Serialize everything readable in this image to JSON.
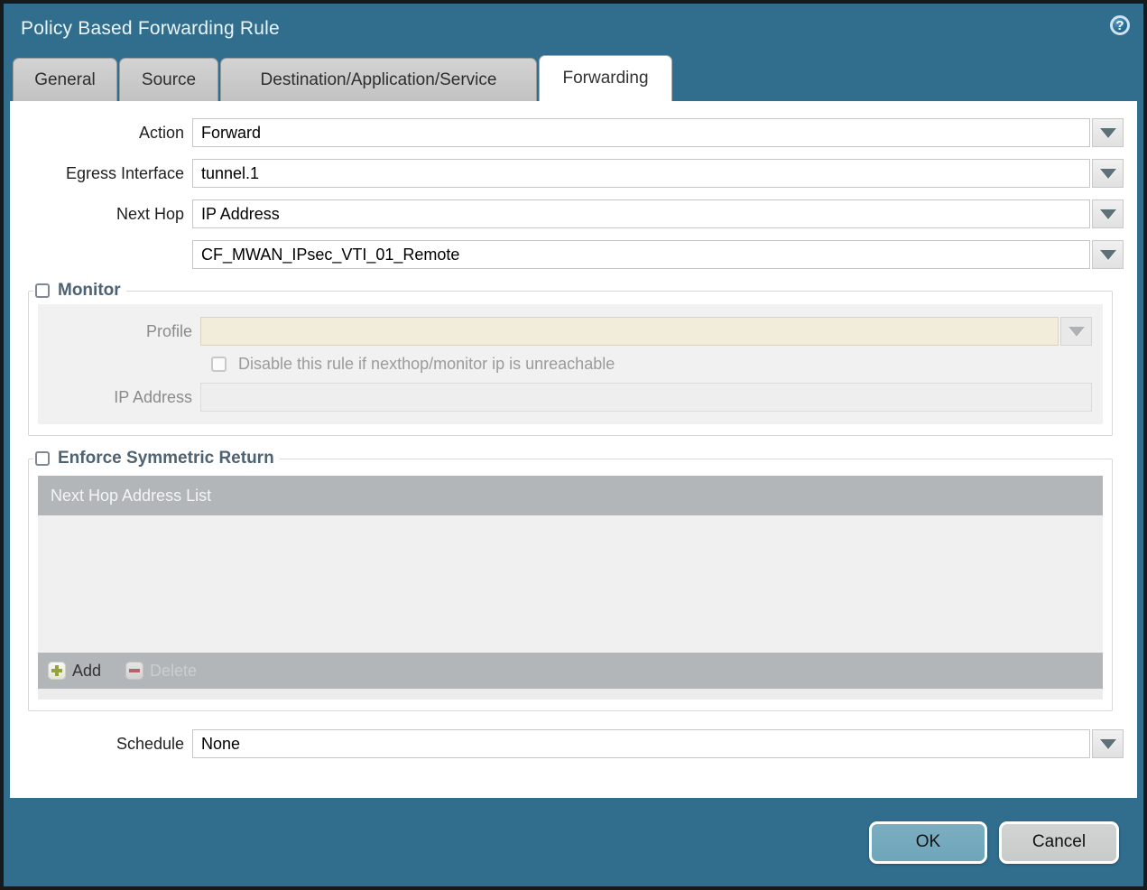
{
  "window": {
    "title": "Policy Based Forwarding Rule"
  },
  "icons": {
    "help_glyph": "?"
  },
  "tabs": [
    {
      "label": "General",
      "active": false
    },
    {
      "label": "Source",
      "active": false
    },
    {
      "label": "Destination/Application/Service",
      "active": false
    },
    {
      "label": "Forwarding",
      "active": true
    }
  ],
  "form": {
    "action": {
      "label": "Action",
      "value": "Forward"
    },
    "egress_interface": {
      "label": "Egress Interface",
      "value": "tunnel.1"
    },
    "next_hop": {
      "label": "Next Hop",
      "value": "IP Address"
    },
    "next_hop_address": {
      "value": "CF_MWAN_IPsec_VTI_01_Remote"
    },
    "schedule": {
      "label": "Schedule",
      "value": "None"
    }
  },
  "monitor": {
    "legend": "Monitor",
    "checked": false,
    "profile": {
      "label": "Profile",
      "value": ""
    },
    "disable_rule": {
      "label": "Disable this rule if nexthop/monitor ip is unreachable",
      "checked": false
    },
    "ip_address": {
      "label": "IP Address",
      "value": ""
    }
  },
  "symmetric_return": {
    "legend": "Enforce Symmetric Return",
    "checked": false,
    "table": {
      "header": "Next Hop Address List",
      "rows": []
    },
    "toolbar": {
      "add_label": "Add",
      "delete_label": "Delete",
      "delete_enabled": false
    }
  },
  "footer": {
    "ok_label": "OK",
    "cancel_label": "Cancel"
  },
  "colors": {
    "frame_teal": "#316E8D",
    "ok_button": "#6FA6BA",
    "cancel_button": "#C9CBCB",
    "add_plus_green": "#97A23C",
    "delete_minus_red": "#B5656A",
    "profile_field_bg": "#F2ECDA",
    "table_header_bg": "#B2B6B9",
    "legend_text": "#4D6272"
  }
}
